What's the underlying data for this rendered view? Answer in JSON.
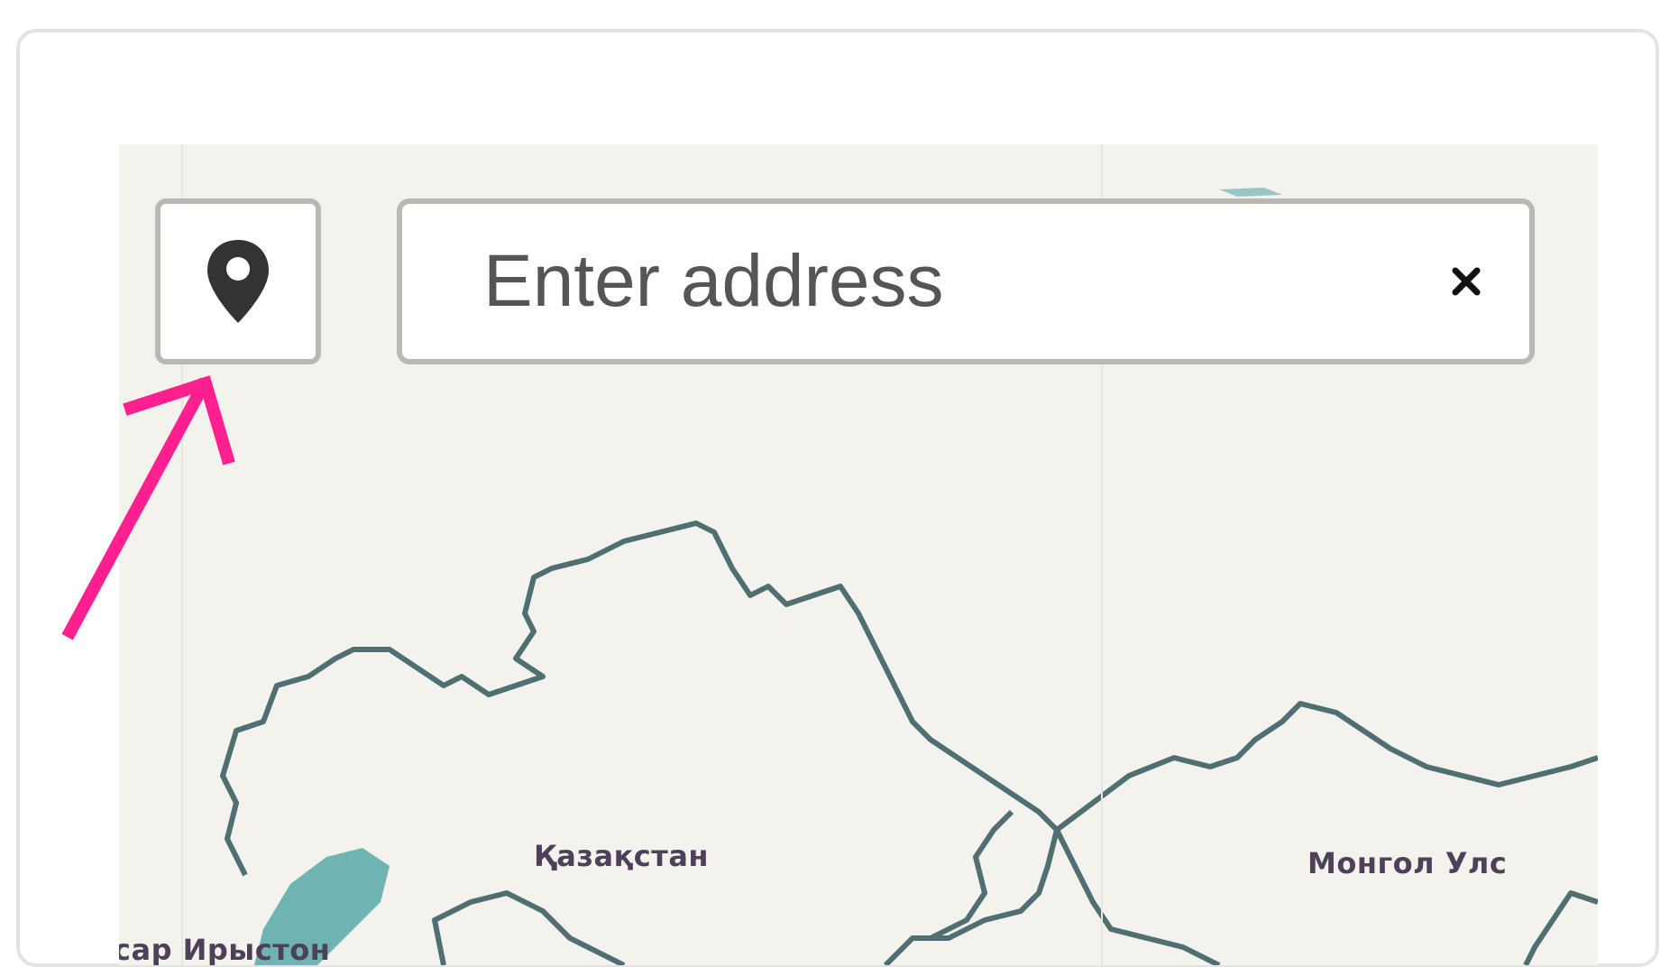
{
  "search": {
    "placeholder": "Enter address",
    "value": ""
  },
  "controls": {
    "locate_icon": "map-pin-icon",
    "clear_icon": "close-icon"
  },
  "map": {
    "labels": {
      "kazakhstan": "Қазақстан",
      "mongolia": "Монгол Улс",
      "ossetia": "сар Ирыстон"
    }
  },
  "annotation": {
    "arrow_color": "#ff1f8e"
  },
  "colors": {
    "map_background": "#f3f2ed",
    "border_line": "#4f6f73",
    "water": "#6fb3b3",
    "control_border": "#b9b8b2"
  }
}
